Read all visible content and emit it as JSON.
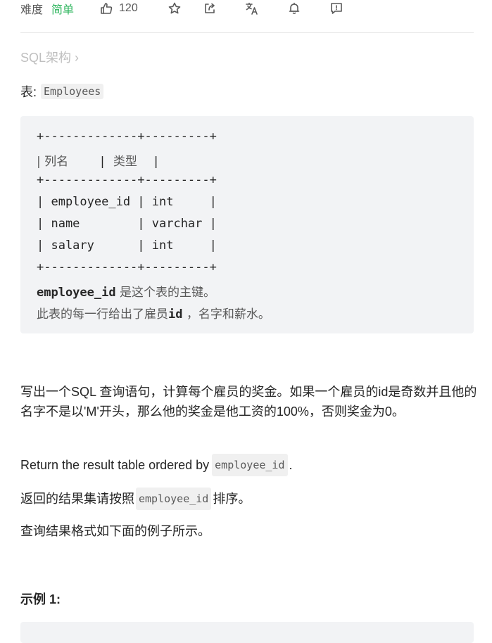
{
  "toolbar": {
    "difficulty_label": "难度",
    "difficulty_value": "简单",
    "like_count": "120",
    "icons": [
      "thumbs-up-icon",
      "star-icon",
      "share-icon",
      "translate-icon",
      "bell-icon",
      "feedback-icon"
    ],
    "colors": {
      "difficulty_easy": "#2db55d",
      "muted": "#595959"
    }
  },
  "breadcrumb": {
    "label": "SQL架构 ›"
  },
  "table_intro": {
    "prefix": "表:",
    "table_name": "Employees"
  },
  "schema": {
    "border": "+-------------+---------+",
    "header": {
      "col1": "| 列名        ",
      "sep": "| ",
      "col2": "类型    ",
      "end": "|"
    },
    "rows": [
      "| employee_id | int     |",
      "| name        | varchar |",
      "| salary      | int     |"
    ],
    "note1": {
      "code": "employee_id",
      "text": " 是这个表的主键。"
    },
    "note2": {
      "text": "此表的每一行给出了雇员",
      "code": "id",
      "text2": " ，名字和薪水。"
    }
  },
  "description": {
    "p1": "写出一个SQL 查询语句，计算每个雇员的奖金。如果一个雇员的id是奇数并且他的名字不是以'M'开头，那么他的奖金是他工资的100%，否则奖金为0。",
    "p2_text": "Return the result table ordered by",
    "p2_code": "employee_id",
    "p2_end": ".",
    "p3_text": "返回的结果集请按照",
    "p3_code": "employee_id",
    "p3_end": "排序。",
    "p4": "查询结果格式如下面的例子所示。"
  },
  "example": {
    "title": "示例 1:"
  }
}
